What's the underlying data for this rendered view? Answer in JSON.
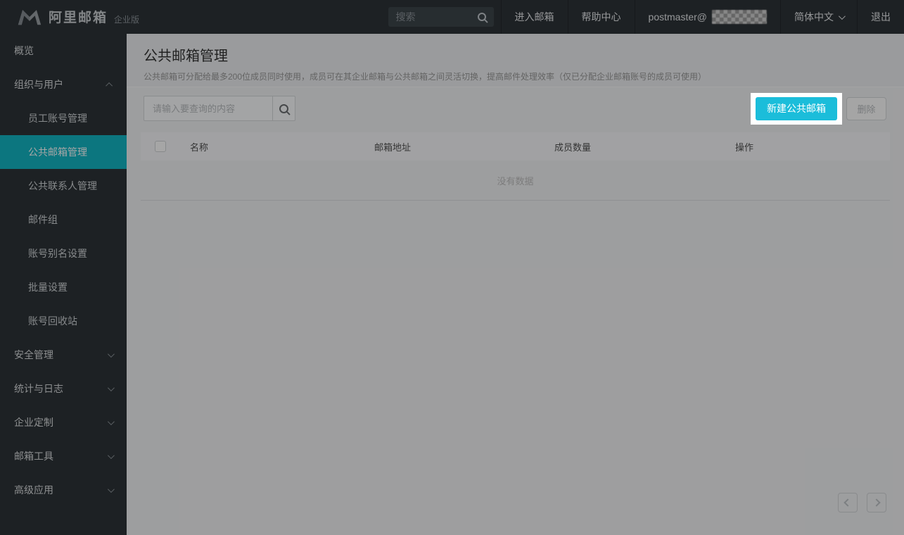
{
  "topbar": {
    "logo": {
      "text": "阿里邮箱",
      "badge": "企业版"
    },
    "search": {
      "placeholder": "搜索"
    },
    "nav": {
      "enter_mailbox": "进入邮箱",
      "help_center": "帮助中心",
      "account_prefix": "postmaster@",
      "language": "简体中文",
      "logout": "退出"
    }
  },
  "sidebar": {
    "items": [
      {
        "label": "概览"
      },
      {
        "label": "组织与用户"
      },
      {
        "label": "员工账号管理"
      },
      {
        "label": "公共邮箱管理"
      },
      {
        "label": "公共联系人管理"
      },
      {
        "label": "邮件组"
      },
      {
        "label": "账号别名设置"
      },
      {
        "label": "批量设置"
      },
      {
        "label": "账号回收站"
      },
      {
        "label": "安全管理"
      },
      {
        "label": "统计与日志"
      },
      {
        "label": "企业定制"
      },
      {
        "label": "邮箱工具"
      },
      {
        "label": "高级应用"
      }
    ],
    "active_item": "公共邮箱管理"
  },
  "page": {
    "title": "公共邮箱管理",
    "description": "公共邮箱可分配给最多200位成员同时使用，成员可在其企业邮箱与公共邮箱之间灵活切换，提高邮件处理效率（仅已分配企业邮箱账号的成员可使用）",
    "toolbar": {
      "search_placeholder": "请输入要查询的内容",
      "create_button": "新建公共邮箱",
      "delete_button": "删除"
    },
    "table": {
      "columns": [
        "名称",
        "邮箱地址",
        "成员数量",
        "操作"
      ],
      "rows": [],
      "empty_text": "没有数据"
    }
  },
  "icons": {
    "logo": "alimail-m-logo",
    "topbar_search": "magnifier",
    "toolbar_search": "magnifier",
    "language_chevron": "chevron-down",
    "expanded_chevron": "chevron-up",
    "collapsed_chevron": "chevron-down",
    "pager_prev": "chevron-left",
    "pager_next": "chevron-right"
  },
  "colors": {
    "accent_cyan": "#1bbdda",
    "sidebar_active_bg": "#13b5c3",
    "chrome_bg": "#2d3338",
    "spotlight_box": "#ffffff",
    "overlay": "rgba(0,0,0,0.35)"
  }
}
